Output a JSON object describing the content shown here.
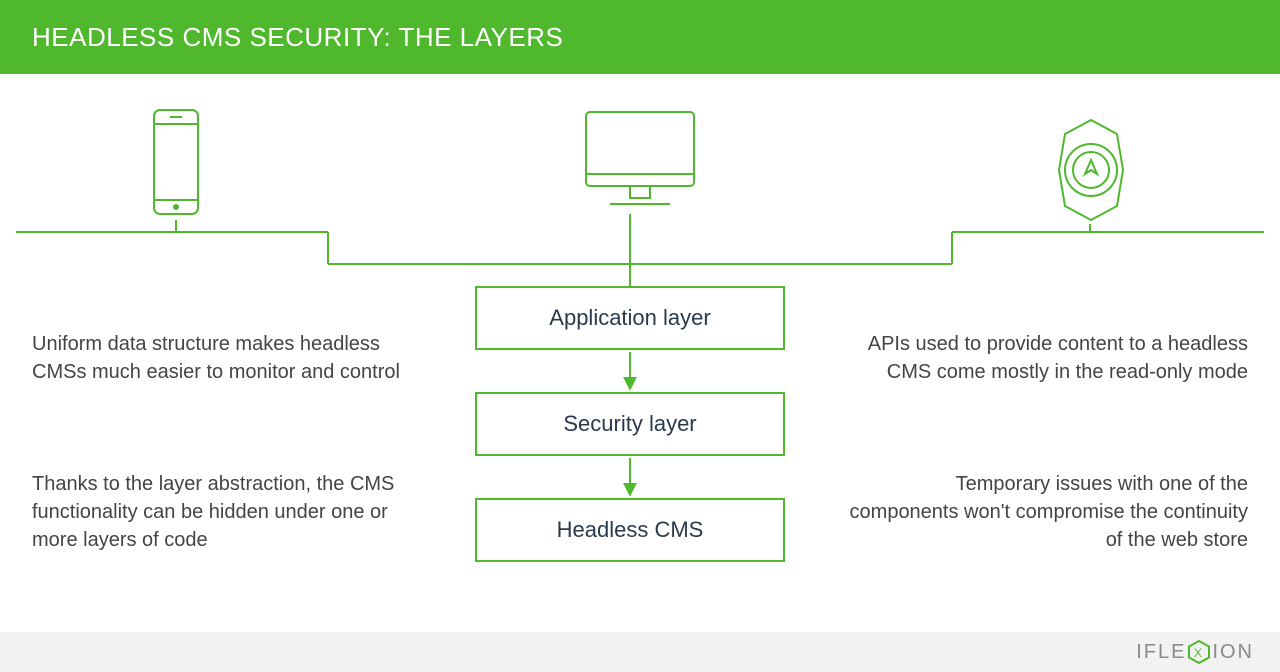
{
  "header": {
    "title": "HEADLESS CMS SECURITY: THE LAYERS"
  },
  "layers": {
    "application": "Application layer",
    "security": "Security layer",
    "headless": "Headless CMS"
  },
  "blurbs": {
    "left1": "Uniform data structure makes headless CMSs much easier to monitor and control",
    "left2": "Thanks to the layer abstraction, the CMS functionality can be hidden under one or more layers of code",
    "right1": "APIs used to provide content to a headless CMS come mostly in the read-only mode",
    "right2": "Temporary issues with one of the components won't compromise the continuity of the web store"
  },
  "logo": {
    "pre": "IFLE",
    "post": "ION",
    "hex_letter": "X"
  },
  "colors": {
    "accent": "#4fb82d",
    "text": "#2a3a4a"
  }
}
